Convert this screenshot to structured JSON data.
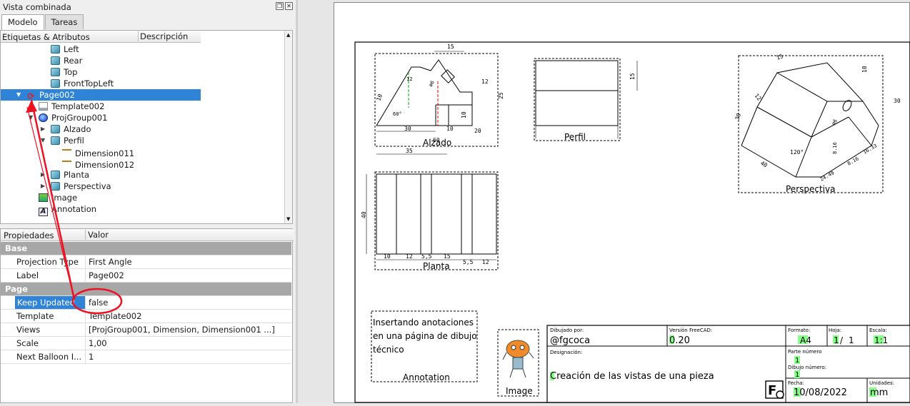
{
  "panel": {
    "title": "Vista combinada",
    "tabs": [
      "Modelo",
      "Tareas"
    ],
    "tree_headers": [
      "Etiquetas & Atributos",
      "Descripción"
    ],
    "tree": [
      {
        "label": "Left",
        "icon": "cube-icon"
      },
      {
        "label": "Rear",
        "icon": "cube-icon"
      },
      {
        "label": "Top",
        "icon": "cube-icon"
      },
      {
        "label": "FrontTopLeft",
        "icon": "cube-icon"
      },
      {
        "label": "Page002",
        "icon": "refresh-icon",
        "selected": true
      },
      {
        "label": "Template002",
        "icon": "template-icon"
      },
      {
        "label": "ProjGroup001",
        "icon": "projgroup-icon"
      },
      {
        "label": "Alzado",
        "icon": "cube-icon"
      },
      {
        "label": "Perfil",
        "icon": "cube-icon"
      },
      {
        "label": "Dimension011",
        "icon": "dimension-horizontal-icon"
      },
      {
        "label": "Dimension012",
        "icon": "dimension-vertical-icon"
      },
      {
        "label": "Planta",
        "icon": "cube-icon"
      },
      {
        "label": "Perspectiva",
        "icon": "cube-icon"
      },
      {
        "label": "Image",
        "icon": "image-icon"
      },
      {
        "label": "Annotation",
        "icon": "annotation-icon"
      }
    ],
    "prop_headers": [
      "Propiedades",
      "Valor"
    ],
    "props": [
      {
        "group": "Base"
      },
      {
        "key": "Projection Type",
        "value": "First Angle"
      },
      {
        "key": "Label",
        "value": "Page002"
      },
      {
        "group": "Page"
      },
      {
        "key": "Keep Updated",
        "value": "false",
        "selected": true
      },
      {
        "key": "Template",
        "value": "Template002"
      },
      {
        "key": "Views",
        "value": "[ProjGroup001, Dimension, Dimension001 ...]"
      },
      {
        "key": "Scale",
        "value": "1,00"
      },
      {
        "key": "Next Balloon I...",
        "value": "1"
      }
    ]
  },
  "drawing": {
    "views": {
      "alzado": "Alzado",
      "perfil": "Perfil",
      "planta": "Planta",
      "perspectiva": "Perspectiva",
      "image": "Image",
      "annotation": "Annotation"
    },
    "annotation_text": [
      "Insertando anotaciones",
      "en una página de dibujo",
      "técnico"
    ],
    "alzado_dims": [
      "15",
      "12",
      "12",
      "25",
      "10",
      "10",
      "60°",
      "ø6",
      "30",
      "10",
      "20",
      "35"
    ],
    "alzado_dims_extra": [
      "60"
    ],
    "perfil_dims": [
      "15"
    ],
    "planta_dims": [
      "10",
      "12",
      "5,5",
      "15",
      "5,5",
      "12",
      "40"
    ],
    "persp_dims": [
      "10",
      "15",
      "12",
      "30",
      "30",
      "120°",
      "8.16",
      "8.16",
      "16.33",
      "24.49",
      "ø6",
      "40"
    ],
    "titleblock": {
      "drawn_by_label": "Dibujado por:",
      "drawn_by": "@fgcoca",
      "version_label": "Versión FreeCAD:",
      "version": "0.20",
      "format_label": "Formato:",
      "format": "A4",
      "sheet_label": "Hoja:",
      "sheet": "1",
      "sheet_sep": "/",
      "sheet_total": "1",
      "scale_label": "Escala:",
      "scale": "1:1",
      "designation_label": "Designación:",
      "designation": "Creación de las vistas de una pieza",
      "part_label": "Parte número",
      "part": "1",
      "drawing_num_label": "Dibujo número:",
      "drawing_num": "1",
      "date_label": "Fecha:",
      "date": "10/08/2022",
      "units_label": "Unidades:",
      "units": "mm"
    }
  }
}
